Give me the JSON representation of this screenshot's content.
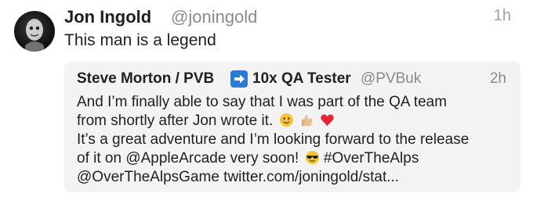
{
  "tweet": {
    "author_name": "Jon Ingold",
    "author_handle": "@joningold",
    "time": "1h",
    "text": "This man is a legend"
  },
  "quoted_tweet": {
    "author_name_part1": "Steve Morton / PVB",
    "arrow_icon": "right-arrow-emoji-icon",
    "author_name_part2": "10x QA Tester",
    "author_handle": "@PVBuk",
    "time": "2h",
    "lines": [
      "And I’m finally able to say that I was part of the QA team",
      "from shortly after Jon wrote it.",
      "It’s a great adventure and I’m looking forward to the release",
      "of it on @AppleArcade very soon!",
      "@OverTheAlpsGame twitter.com/joningold/stat..."
    ],
    "line4_hashtag": "#OverTheAlps"
  },
  "colors": {
    "name_text": "#1f1f1f",
    "secondary_text": "#8a8a8a",
    "quote_background": "#f3f3f4",
    "arrow_emoji_blue": "#2a7ad9"
  }
}
